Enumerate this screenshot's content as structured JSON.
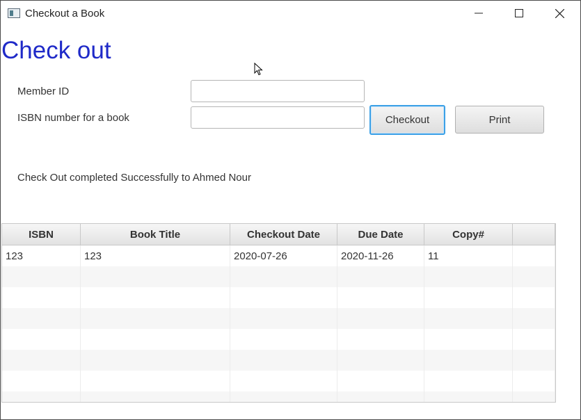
{
  "window": {
    "title": "Checkout a Book",
    "controls": {
      "minimize": "minimize",
      "maximize": "maximize",
      "close": "close"
    }
  },
  "page": {
    "heading": "Check out",
    "member_label": "Member ID",
    "member_value": "",
    "isbn_label": "ISBN number for a book",
    "isbn_value": "",
    "checkout_button": "Checkout",
    "print_button": "Print",
    "status_message": "Check Out completed Successfully to Ahmed Nour"
  },
  "table": {
    "columns": [
      "ISBN",
      "Book Title",
      "Checkout Date",
      "Due Date",
      "Copy#",
      ""
    ],
    "rows": [
      [
        "123",
        "123",
        "2020-07-26",
        "2020-11-26",
        "11",
        ""
      ]
    ]
  },
  "colors": {
    "heading": "#1f2ac8",
    "focus_border": "#3ca0e6"
  }
}
